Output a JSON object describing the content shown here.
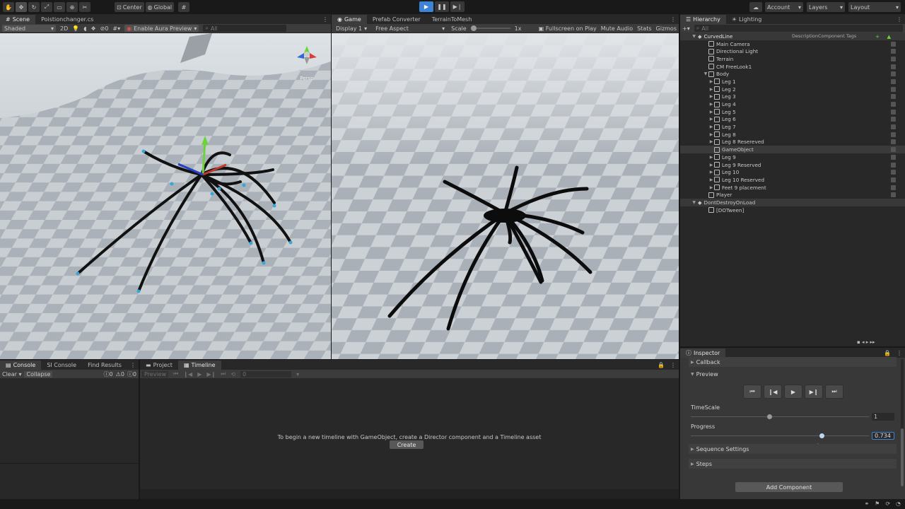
{
  "toolbar": {
    "pivot_label": "Center",
    "space_label": "Global",
    "account_label": "Account",
    "layers_label": "Layers",
    "layout_label": "Layout"
  },
  "scene": {
    "tabs": [
      "Scene",
      "Poistionchanger.cs"
    ],
    "shading_mode": "Shaded",
    "mode_2d": "2D",
    "hidden_count": "0",
    "aura_label": "Enable Aura Preview",
    "search_placeholder": "All",
    "gizmo_label": "Persp"
  },
  "game": {
    "tabs": [
      "Game",
      "Prefab Converter",
      "TerrainToMesh"
    ],
    "display": "Display 1",
    "aspect": "Free Aspect",
    "scale_label": "Scale",
    "scale_value": "1x",
    "fullscreen_label": "Fullscreen on Play",
    "mute_label": "Mute Audio",
    "stats_label": "Stats",
    "gizmos_label": "Gizmos"
  },
  "hierarchy": {
    "tabs": [
      "Hierarchy",
      "Lighting"
    ],
    "search_placeholder": "All",
    "scene_name": "CurvedLine",
    "column_text": "DescriptionComponent Tags",
    "items": [
      {
        "label": "Main Camera",
        "depth": 1,
        "fold": ""
      },
      {
        "label": "Directional Light",
        "depth": 1,
        "fold": ""
      },
      {
        "label": "Terrain",
        "depth": 1,
        "fold": ""
      },
      {
        "label": "CM FreeLook1",
        "depth": 1,
        "fold": ""
      },
      {
        "label": "Body",
        "depth": 1,
        "fold": "▼"
      },
      {
        "label": "Leg 1",
        "depth": 2,
        "fold": "▶"
      },
      {
        "label": "Leg 2",
        "depth": 2,
        "fold": "▶"
      },
      {
        "label": "Leg 3",
        "depth": 2,
        "fold": "▶"
      },
      {
        "label": "Leg 4",
        "depth": 2,
        "fold": "▶"
      },
      {
        "label": "Leg 5",
        "depth": 2,
        "fold": "▶"
      },
      {
        "label": "Leg 6",
        "depth": 2,
        "fold": "▶"
      },
      {
        "label": "Leg 7",
        "depth": 2,
        "fold": "▶"
      },
      {
        "label": "Leg 8",
        "depth": 2,
        "fold": "▶"
      },
      {
        "label": "Leg 8 Resereved",
        "depth": 2,
        "fold": "▶"
      },
      {
        "label": "GameObject",
        "depth": 2,
        "fold": "",
        "selected": true
      },
      {
        "label": "Leg 9",
        "depth": 2,
        "fold": "▶"
      },
      {
        "label": "Leg 9 Reserved",
        "depth": 2,
        "fold": "▶"
      },
      {
        "label": "Leg 10",
        "depth": 2,
        "fold": "▶"
      },
      {
        "label": "Leg 10 Reserved",
        "depth": 2,
        "fold": "▶"
      },
      {
        "label": "Feet 9 placement",
        "depth": 2,
        "fold": "▶"
      },
      {
        "label": "Player",
        "depth": 1,
        "fold": ""
      }
    ],
    "dontdestroy_label": "DontDestroyOnLoad",
    "dotween_label": "[DOTween]"
  },
  "inspector": {
    "tab": "Inspector",
    "callback_label": "Callback",
    "preview_label": "Preview",
    "timescale_label": "TimeScale",
    "timescale_value": "1",
    "timescale_fraction": 0.44,
    "progress_label": "Progress",
    "progress_value": "0.734",
    "progress_fraction": 0.734,
    "sequence_label": "Sequence Settings",
    "steps_label": "Steps",
    "add_component_label": "Add Component"
  },
  "console": {
    "tabs": [
      "Console",
      "SI Console",
      "Find Results"
    ],
    "clear_label": "Clear",
    "collapse_label": "Collapse",
    "log_count": "0",
    "warn_count": "0",
    "error_count": "0"
  },
  "timeline": {
    "tabs": [
      "Project",
      "Timeline"
    ],
    "preview_label": "Preview",
    "frame_value": "0",
    "message": "To begin a new timeline with GameObject, create a Director component and a Timeline asset",
    "create_label": "Create"
  },
  "colors": {
    "accent": "#3d83d6",
    "selection": "#2c5d87",
    "panel": "#383838",
    "background": "#191919"
  }
}
